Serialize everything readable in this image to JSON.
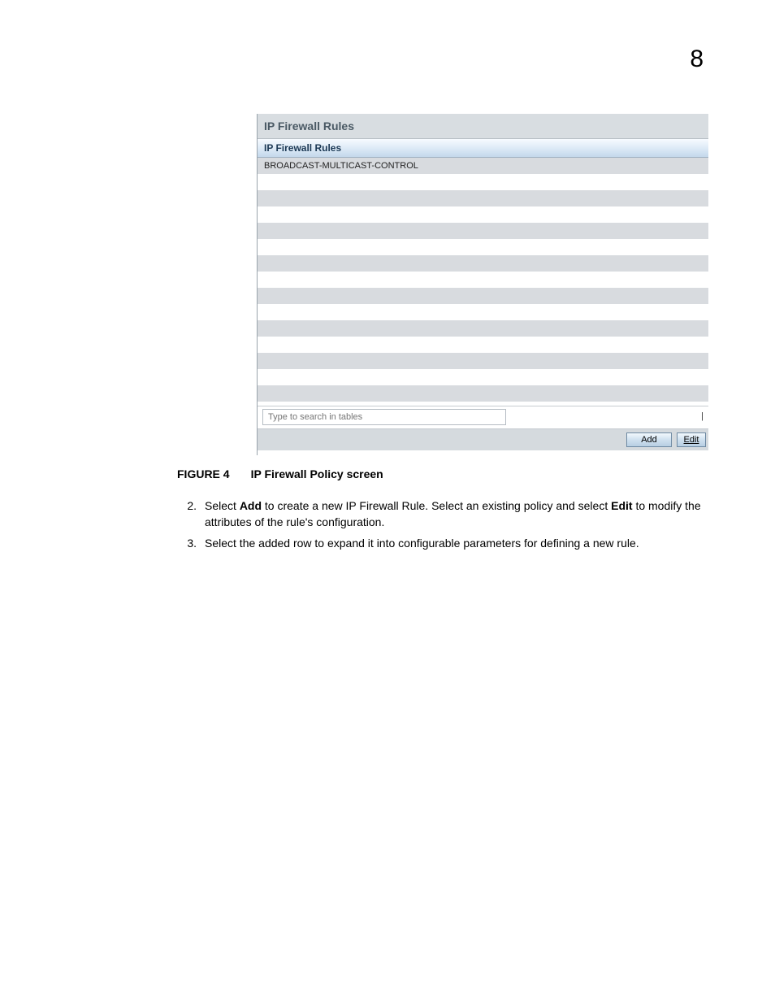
{
  "pageNumber": "8",
  "panel": {
    "title": "IP Firewall Rules",
    "columnHeader": "IP Firewall Rules",
    "rows": [
      "BROADCAST-MULTICAST-CONTROL",
      "",
      "",
      "",
      "",
      "",
      "",
      "",
      "",
      "",
      "",
      "",
      "",
      "",
      ""
    ],
    "searchPlaceholder": "Type to search in tables",
    "buttons": {
      "add": "Add",
      "edit": "Edit"
    }
  },
  "figure": {
    "label": "FIGURE 4",
    "caption": "IP Firewall Policy screen"
  },
  "steps": {
    "item2": {
      "num": "2.",
      "pre": "Select ",
      "b1": "Add",
      "mid": " to create a new IP Firewall Rule. Select an existing policy and select ",
      "b2": "Edit",
      "post": " to modify the attributes of the rule's configuration."
    },
    "item3": {
      "num": "3.",
      "text": "Select the added row to expand it into configurable parameters for defining a new rule."
    }
  }
}
